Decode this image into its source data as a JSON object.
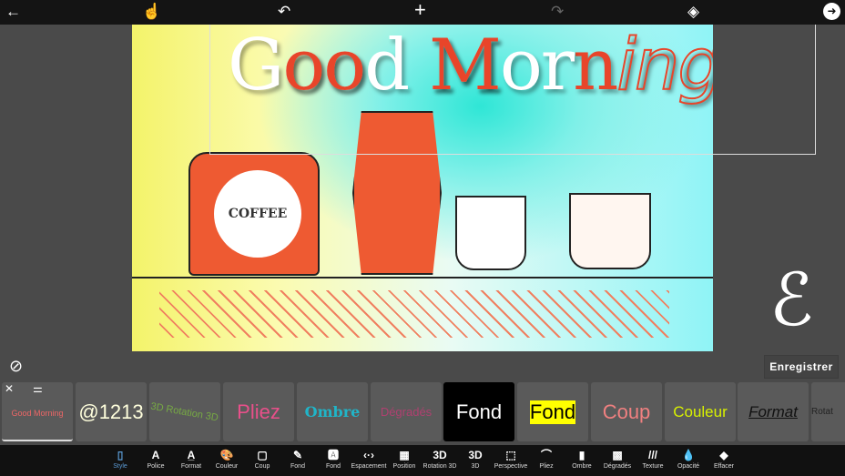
{
  "topbar": {
    "back": "←",
    "touch": "☝",
    "undo": "↶",
    "add": "+",
    "redo": "↷",
    "layers": "◈",
    "next": "➜"
  },
  "canvas": {
    "title_white": "Good ",
    "title_white2": "Mor",
    "title_red1": "oo",
    "title_red2": "n",
    "title_tail": "ing",
    "coffee_label": "COFFEE"
  },
  "actions": {
    "none_icon": "⊘",
    "save": "Enregistrer"
  },
  "tiles": [
    {
      "label": "Good Morning",
      "color": "#e66"
    },
    {
      "label": "@1213",
      "color": "#ffd"
    },
    {
      "label": "3D Rotation 3D",
      "color": "#7a4"
    },
    {
      "label": "Pliez",
      "color": "#e8508a"
    },
    {
      "label": "Ombre",
      "color": "#20b5c8"
    },
    {
      "label": "Dégradés",
      "color": "#b04070"
    },
    {
      "label": "Fond",
      "color": "#ffffff"
    },
    {
      "label": "Fond",
      "color": "#000000"
    },
    {
      "label": "Coup",
      "color": "#f08080"
    },
    {
      "label": "Couleur",
      "color": "#d8f000"
    },
    {
      "label": "Format",
      "color": "#111111"
    },
    {
      "label": "Rotat",
      "color": "#222222"
    }
  ],
  "toolbar": [
    {
      "icon": "▯",
      "label": "Style",
      "active": true
    },
    {
      "icon": "A",
      "label": "Police"
    },
    {
      "icon": "A̲",
      "label": "Format"
    },
    {
      "icon": "🎨",
      "label": "Couleur"
    },
    {
      "icon": "▢",
      "label": "Coup"
    },
    {
      "icon": "✎",
      "label": "Fond"
    },
    {
      "icon": "🅰",
      "label": "Fond"
    },
    {
      "icon": "‹·›",
      "label": "Espacement"
    },
    {
      "icon": "▦",
      "label": "Position"
    },
    {
      "icon": "3D",
      "label": "Rotation 3D"
    },
    {
      "icon": "3D",
      "label": "3D"
    },
    {
      "icon": "⬚",
      "label": "Perspective"
    },
    {
      "icon": "⌒",
      "label": "Pliez"
    },
    {
      "icon": "▮",
      "label": "Ombre"
    },
    {
      "icon": "▩",
      "label": "Dégradés"
    },
    {
      "icon": "///",
      "label": "Texture"
    },
    {
      "icon": "💧",
      "label": "Opacité"
    },
    {
      "icon": "◆",
      "label": "Effacer"
    }
  ],
  "colors": {
    "accent": "#5b9bd5",
    "red": "#e8452a"
  }
}
